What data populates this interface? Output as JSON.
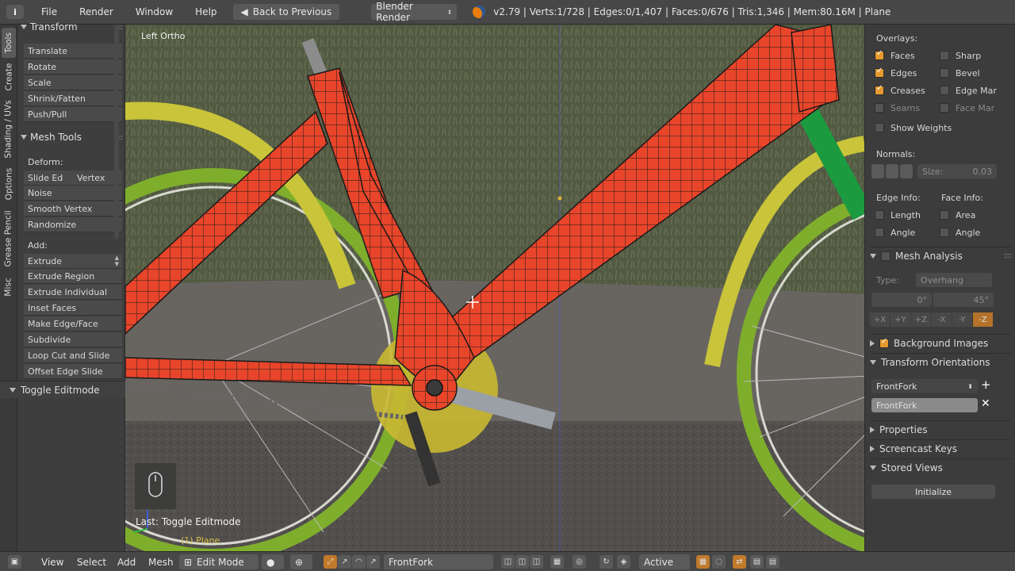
{
  "topbar": {
    "menus": [
      "File",
      "Render",
      "Window",
      "Help"
    ],
    "back_label": "Back to Previous",
    "engine": "Blender Render",
    "stats": "v2.79 | Verts:1/728 | Edges:0/1,407 | Faces:0/676 | Tris:1,346 | Mem:80.16M | Plane"
  },
  "shelf_tabs": [
    "Tools",
    "Create",
    "Shading / UVs",
    "Options",
    "Grease Pencil",
    "Misc"
  ],
  "transform": {
    "title": "Transform",
    "buttons": [
      "Translate",
      "Rotate",
      "Scale",
      "Shrink/Fatten",
      "Push/Pull"
    ]
  },
  "mesh_tools": {
    "title": "Mesh Tools",
    "deform_label": "Deform:",
    "slide_edge": "Slide Ed",
    "vertex": "Vertex",
    "deform_buttons": [
      "Noise",
      "Smooth Vertex",
      "Randomize"
    ],
    "add_label": "Add:",
    "extrude": "Extrude",
    "add_buttons": [
      "Extrude Region",
      "Extrude Individual",
      "Inset Faces",
      "Make Edge/Face",
      "Subdivide",
      "Loop Cut and Slide",
      "Offset Edge Slide"
    ]
  },
  "toggle_editmode": "Toggle Editmode",
  "viewport": {
    "view_name": "Left Ortho",
    "last_op": "Last: Toggle Editmode",
    "object_label": "(1) Plane"
  },
  "props": {
    "overlays_label": "Overlays:",
    "overlays": [
      {
        "label": "Faces",
        "checked": true
      },
      {
        "label": "Sharp",
        "checked": false
      },
      {
        "label": "Edges",
        "checked": true
      },
      {
        "label": "Bevel",
        "checked": false
      },
      {
        "label": "Creases",
        "checked": true
      },
      {
        "label": "Edge Mar",
        "checked": false
      },
      {
        "label": "Seams",
        "checked": false
      },
      {
        "label": "Face Mar",
        "checked": false
      }
    ],
    "show_weights": "Show Weights",
    "normals_label": "Normals:",
    "size_label": "Size:",
    "size_value": "0.03",
    "edge_info_label": "Edge Info:",
    "face_info_label": "Face Info:",
    "length": "Length",
    "area": "Area",
    "angle_edge": "Angle",
    "angle_face": "Angle",
    "mesh_analysis": "Mesh Analysis",
    "type_label": "Type:",
    "type_value": "Overhang",
    "min_value": "0°",
    "max_value": "45°",
    "axes": [
      "+X",
      "+Y",
      "+Z",
      "-X",
      "-Y",
      "-Z"
    ],
    "active_axis": "-Z",
    "background_images": "Background Images",
    "transform_orientations": "Transform Orientations",
    "orientation_value": "FrontFork",
    "orientation_name": "FrontFork",
    "properties": "Properties",
    "screencast_keys": "Screencast Keys",
    "stored_views": "Stored Views",
    "initialize": "Initialize"
  },
  "bottombar": {
    "view": "View",
    "select": "Select",
    "add": "Add",
    "mesh": "Mesh",
    "mode": "Edit Mode",
    "orientation": "FrontFork",
    "pivot": "Active"
  },
  "colors": {
    "mesh_face": "#e8452a",
    "mesh_edge": "#1a1a1a",
    "accent_orange": "#e59a2e",
    "tire_green": "#7fae2c",
    "fender_yellow": "#c9c43a"
  }
}
